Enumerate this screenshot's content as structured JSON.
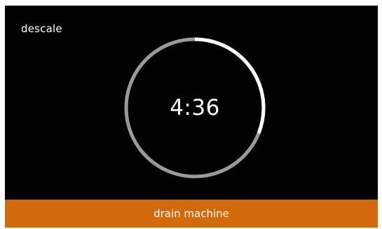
{
  "screen": {
    "title": "descale",
    "timer": {
      "display": "4:36",
      "progress_fraction": 0.31,
      "track_color": "#9a9a9a",
      "progress_color": "#ffffff"
    },
    "action": {
      "label": "drain machine",
      "color": "#d2690a"
    }
  }
}
